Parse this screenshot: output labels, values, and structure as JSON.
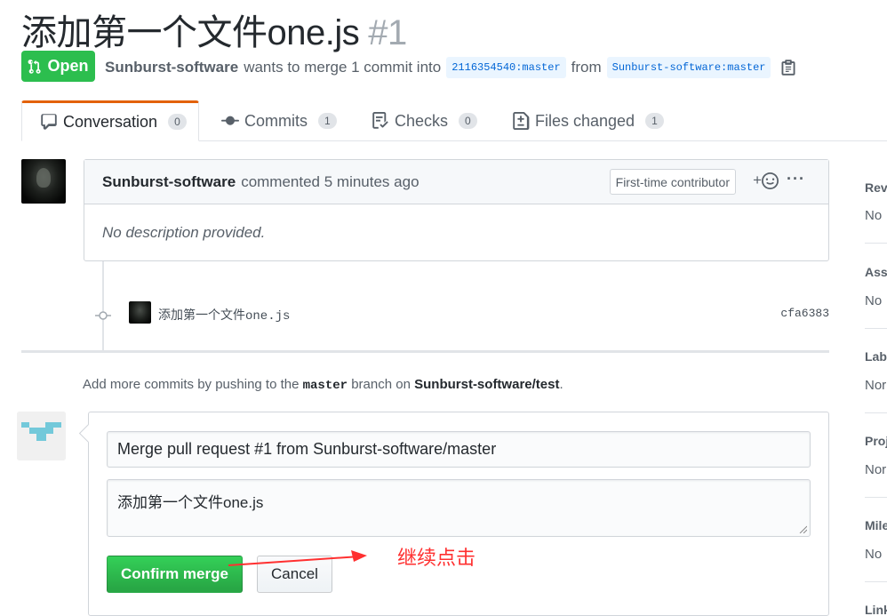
{
  "pr": {
    "title": "添加第一个文件one.js",
    "number": "#1",
    "state": "Open",
    "author": "Sunburst-software",
    "merge_text": "wants to merge 1 commit into",
    "base_branch": "2116354540:master",
    "from_text": "from",
    "head_branch": "Sunburst-software:master"
  },
  "tabs": [
    {
      "label": "Conversation",
      "count": "0"
    },
    {
      "label": "Commits",
      "count": "1"
    },
    {
      "label": "Checks",
      "count": "0"
    },
    {
      "label": "Files changed",
      "count": "1"
    }
  ],
  "comment": {
    "author": "Sunburst-software",
    "action": "commented 5 minutes ago",
    "badge": "First-time contributor",
    "emoji": "+☺",
    "more": "···",
    "body": "No description provided."
  },
  "commit": {
    "message": "添加第一个文件one.js",
    "sha": "cfa6383"
  },
  "push_info": {
    "prefix": "Add more commits by pushing to the",
    "branch": "master",
    "middle": "branch on",
    "repo": "Sunburst-software/test",
    "suffix": "."
  },
  "merge_form": {
    "title_value": "Merge pull request #1 from Sunburst-software/master",
    "description_value": "添加第一个文件one.js",
    "confirm_label": "Confirm merge",
    "cancel_label": "Cancel"
  },
  "annotation": {
    "text": "继续点击",
    "color": "#ff3030"
  },
  "sidebar": [
    {
      "heading": "Rev",
      "value": "No"
    },
    {
      "heading": "Assi",
      "value": "No"
    },
    {
      "heading": "Labe",
      "value": "Nor"
    },
    {
      "heading": "Proj",
      "value": "Nor"
    },
    {
      "heading": "Mile",
      "value": "No"
    },
    {
      "heading": "Link",
      "value": ""
    }
  ],
  "colors": {
    "open_green": "#2cbe4e",
    "active_tab_accent": "#e36209",
    "link_blue": "#0366d6"
  }
}
